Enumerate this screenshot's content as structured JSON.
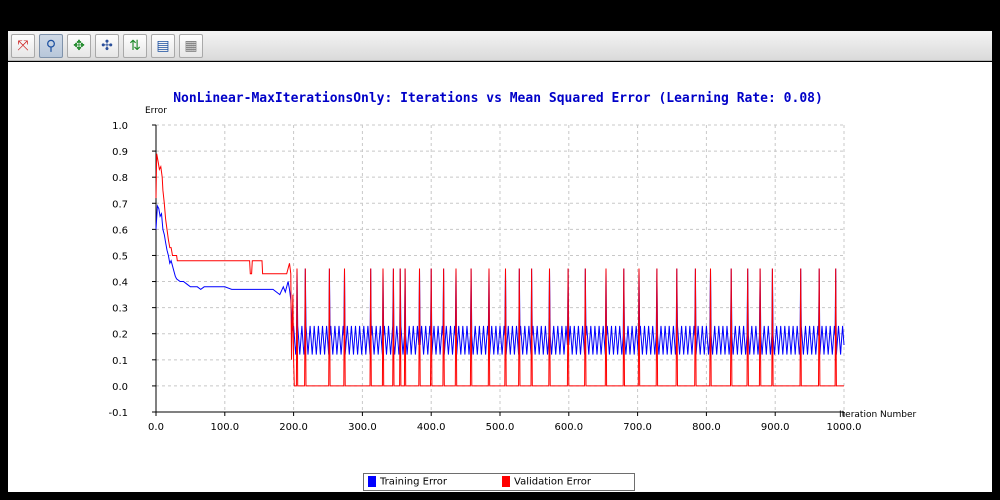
{
  "toolbar": {
    "buttons": [
      {
        "icon": "zoom-fit-icon",
        "glyph": "⤧",
        "color": "#cc2222",
        "active": false
      },
      {
        "icon": "zoom-icon",
        "glyph": "⚲",
        "color": "#1a4fa0",
        "active": true
      },
      {
        "icon": "pan-icon",
        "glyph": "✥",
        "color": "#1f8a2a",
        "active": false
      },
      {
        "icon": "crosshair-icon",
        "glyph": "✣",
        "color": "#2a4f9a",
        "active": false
      },
      {
        "icon": "data-points-icon",
        "glyph": "⇅",
        "color": "#1f8a2a",
        "active": false
      },
      {
        "icon": "export-icon",
        "glyph": "▤",
        "color": "#1a4fa0",
        "active": false
      },
      {
        "icon": "table-icon",
        "glyph": "▦",
        "color": "#777777",
        "active": false
      }
    ]
  },
  "chart_data": {
    "type": "line",
    "title": "NonLinear-MaxIterationsOnly: Iterations vs Mean Squared Error (Learning Rate: 0.08)",
    "xlabel": "Iteration Number",
    "ylabel": "Error",
    "xlim": [
      0,
      1000
    ],
    "ylim": [
      -0.1,
      1.0
    ],
    "x_ticks": [
      "0.0",
      "100.0",
      "200.0",
      "300.0",
      "400.0",
      "500.0",
      "600.0",
      "700.0",
      "800.0",
      "900.0",
      "1000.0"
    ],
    "y_ticks": [
      "-0.1",
      "0.0",
      "0.1",
      "0.2",
      "0.3",
      "0.4",
      "0.5",
      "0.6",
      "0.7",
      "0.8",
      "0.9",
      "1.0"
    ],
    "grid": true,
    "legend_position": "bottom-center",
    "series": [
      {
        "name": "Training Error",
        "color": "#0000ff",
        "early_x": [
          0,
          2,
          4,
          6,
          8,
          10,
          12,
          14,
          16,
          18,
          20,
          22,
          24,
          26,
          28,
          30,
          35,
          40,
          45,
          50,
          55,
          60,
          65,
          70,
          80,
          90,
          100,
          110,
          120,
          130,
          140,
          150,
          160,
          170,
          175,
          180,
          185,
          188,
          190,
          192,
          194,
          196,
          198
        ],
        "early_y": [
          0.6,
          0.69,
          0.68,
          0.65,
          0.66,
          0.6,
          0.58,
          0.55,
          0.52,
          0.5,
          0.47,
          0.48,
          0.46,
          0.44,
          0.42,
          0.41,
          0.4,
          0.4,
          0.39,
          0.38,
          0.38,
          0.38,
          0.37,
          0.38,
          0.38,
          0.38,
          0.38,
          0.37,
          0.37,
          0.37,
          0.37,
          0.37,
          0.37,
          0.37,
          0.36,
          0.35,
          0.38,
          0.36,
          0.38,
          0.4,
          0.37,
          0.33,
          0.21
        ],
        "osc_start": 200,
        "osc_end": 1000,
        "osc_period": 6,
        "osc_min": 0.12,
        "osc_max": 0.23,
        "spikes_x": [
          205,
          217,
          252,
          274,
          312,
          330,
          345,
          355,
          362,
          383,
          400,
          418,
          436,
          458,
          484,
          508,
          528,
          546,
          572,
          599,
          624,
          654,
          680,
          702,
          728,
          757,
          784,
          806,
          836,
          860,
          878,
          896,
          937,
          964,
          988
        ],
        "spike_height": 0.45
      },
      {
        "name": "Validation Error",
        "color": "#ff0000",
        "early_x": [
          0,
          1,
          3,
          5,
          7,
          9,
          10,
          12,
          14,
          16,
          18,
          20,
          22,
          24,
          26,
          28,
          30,
          31,
          45,
          46,
          136,
          137,
          139,
          140,
          146,
          147,
          154,
          155,
          190,
          194,
          196,
          197,
          199,
          200,
          201
        ],
        "early_y": [
          0.72,
          0.89,
          0.86,
          0.83,
          0.84,
          0.8,
          0.75,
          0.7,
          0.64,
          0.6,
          0.56,
          0.53,
          0.53,
          0.5,
          0.5,
          0.5,
          0.5,
          0.48,
          0.48,
          0.48,
          0.48,
          0.43,
          0.43,
          0.48,
          0.48,
          0.48,
          0.48,
          0.43,
          0.43,
          0.47,
          0.43,
          0.1,
          0.35,
          0.1,
          0.0
        ],
        "baseline": 0.0,
        "spike_height": 0.45
      }
    ]
  },
  "legend": {
    "items": [
      {
        "name": "Training Error",
        "color": "#0000ff"
      },
      {
        "name": "Validation Error",
        "color": "#ff0000"
      }
    ]
  }
}
